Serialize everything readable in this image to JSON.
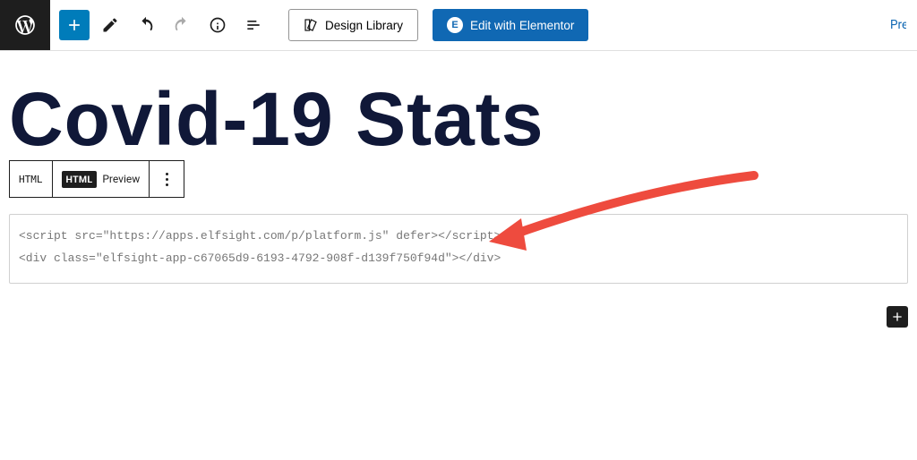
{
  "toolbar": {
    "design_library_label": "Design Library",
    "elementor_label": "Edit with Elementor",
    "preview_label": "Preview"
  },
  "page": {
    "title": "Covid-19 Stats"
  },
  "block_toolbar": {
    "type_label": "HTML",
    "html_tab": "HTML",
    "preview_tab": "Preview"
  },
  "code": {
    "line1": "<script src=\"https://apps.elfsight.com/p/platform.js\" defer></script>",
    "line2": "<div class=\"elfsight-app-c67065d9-6193-4792-908f-d139f750f94d\"></div>"
  }
}
